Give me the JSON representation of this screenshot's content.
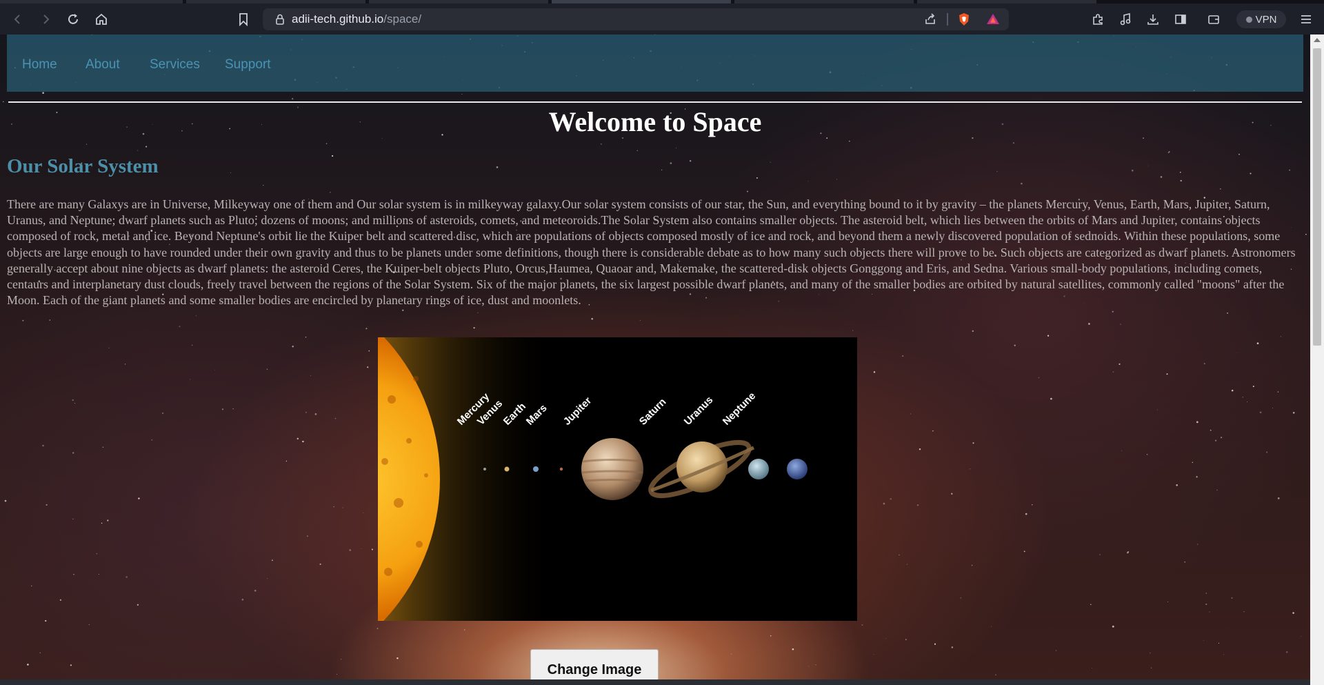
{
  "browser": {
    "url_host": "adii-tech.github.io",
    "url_path": "/space/",
    "vpn_label": "VPN",
    "icons": [
      "back-icon",
      "forward-icon",
      "reload-icon",
      "home-icon",
      "bookmark-icon",
      "lock-icon",
      "share-icon",
      "brave-shields-icon",
      "brave-rewards-icon",
      "extensions-icon",
      "media-icon",
      "downloads-icon",
      "sidebar-icon",
      "wallet-icon",
      "menu-icon"
    ]
  },
  "nav": {
    "items": [
      {
        "label": "Home"
      },
      {
        "label": "About"
      },
      {
        "label": "Services"
      },
      {
        "label": "Support"
      }
    ]
  },
  "page": {
    "title": "Welcome to Space",
    "section_heading": "Our Solar System",
    "intro": "There are many Galaxys are in Universe, Milkeyway one of them and Our solar system is in milkeyway galaxy.Our solar system consists of our star, the Sun, and everything bound to it by gravity – the planets Mercury, Venus, Earth, Mars, Jupiter, Saturn, Uranus, and Neptune; dwarf planets such as Pluto; dozens of moons; and millions of asteroids, comets, and meteoroids.The Solar System also contains smaller objects. The asteroid belt, which lies between the orbits of Mars and Jupiter, contains objects composed of rock, metal and ice. Beyond Neptune's orbit lie the Kuiper belt and scattered disc, which are populations of objects composed mostly of ice and rock, and beyond them a newly discovered population of sednoids. Within these populations, some objects are large enough to have rounded under their own gravity and thus to be planets under some definitions, though there is considerable debate as to how many such objects there will prove to be. Such objects are categorized as dwarf planets. Astronomers generally accept about nine objects as dwarf planets: the asteroid Ceres, the Kuiper-belt objects Pluto, Orcus,Haumea, Quaoar and, Makemake, the scattered-disk objects Gonggong and Eris, and Sedna. Various small-body populations, including comets, centaurs and interplanetary dust clouds, freely travel between the regions of the Solar System. Six of the major planets, the six largest possible dwarf planets, and many of the smaller bodies are orbited by natural satellites, commonly called \"moons\" after the Moon. Each of the giant planets and some smaller bodies are encircled by planetary rings of ice, dust and moonlets.",
    "button_label": "Change Image"
  },
  "solar_image": {
    "planet_labels": [
      "Mercury",
      "Venus",
      "Earth",
      "Mars",
      "Jupiter",
      "Saturn",
      "Uranus",
      "Neptune"
    ]
  },
  "colors": {
    "nav_link": "#4a93b5",
    "section_heading": "#4c8fa8",
    "body_text": "#b9b3b3",
    "title": "#ffffff"
  }
}
